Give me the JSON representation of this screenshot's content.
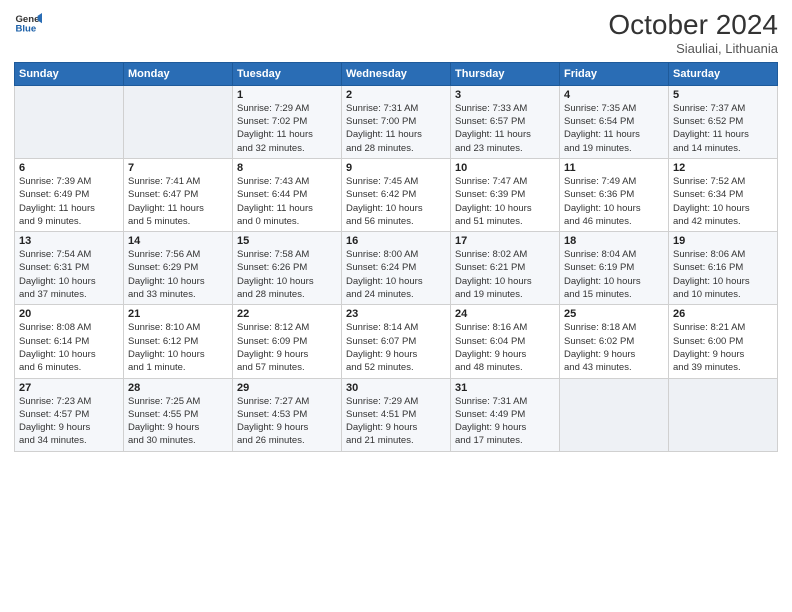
{
  "logo": {
    "line1": "General",
    "line2": "Blue"
  },
  "title": "October 2024",
  "subtitle": "Siauliai, Lithuania",
  "header_days": [
    "Sunday",
    "Monday",
    "Tuesday",
    "Wednesday",
    "Thursday",
    "Friday",
    "Saturday"
  ],
  "weeks": [
    [
      {
        "day": "",
        "info": ""
      },
      {
        "day": "",
        "info": ""
      },
      {
        "day": "1",
        "info": "Sunrise: 7:29 AM\nSunset: 7:02 PM\nDaylight: 11 hours\nand 32 minutes."
      },
      {
        "day": "2",
        "info": "Sunrise: 7:31 AM\nSunset: 7:00 PM\nDaylight: 11 hours\nand 28 minutes."
      },
      {
        "day": "3",
        "info": "Sunrise: 7:33 AM\nSunset: 6:57 PM\nDaylight: 11 hours\nand 23 minutes."
      },
      {
        "day": "4",
        "info": "Sunrise: 7:35 AM\nSunset: 6:54 PM\nDaylight: 11 hours\nand 19 minutes."
      },
      {
        "day": "5",
        "info": "Sunrise: 7:37 AM\nSunset: 6:52 PM\nDaylight: 11 hours\nand 14 minutes."
      }
    ],
    [
      {
        "day": "6",
        "info": "Sunrise: 7:39 AM\nSunset: 6:49 PM\nDaylight: 11 hours\nand 9 minutes."
      },
      {
        "day": "7",
        "info": "Sunrise: 7:41 AM\nSunset: 6:47 PM\nDaylight: 11 hours\nand 5 minutes."
      },
      {
        "day": "8",
        "info": "Sunrise: 7:43 AM\nSunset: 6:44 PM\nDaylight: 11 hours\nand 0 minutes."
      },
      {
        "day": "9",
        "info": "Sunrise: 7:45 AM\nSunset: 6:42 PM\nDaylight: 10 hours\nand 56 minutes."
      },
      {
        "day": "10",
        "info": "Sunrise: 7:47 AM\nSunset: 6:39 PM\nDaylight: 10 hours\nand 51 minutes."
      },
      {
        "day": "11",
        "info": "Sunrise: 7:49 AM\nSunset: 6:36 PM\nDaylight: 10 hours\nand 46 minutes."
      },
      {
        "day": "12",
        "info": "Sunrise: 7:52 AM\nSunset: 6:34 PM\nDaylight: 10 hours\nand 42 minutes."
      }
    ],
    [
      {
        "day": "13",
        "info": "Sunrise: 7:54 AM\nSunset: 6:31 PM\nDaylight: 10 hours\nand 37 minutes."
      },
      {
        "day": "14",
        "info": "Sunrise: 7:56 AM\nSunset: 6:29 PM\nDaylight: 10 hours\nand 33 minutes."
      },
      {
        "day": "15",
        "info": "Sunrise: 7:58 AM\nSunset: 6:26 PM\nDaylight: 10 hours\nand 28 minutes."
      },
      {
        "day": "16",
        "info": "Sunrise: 8:00 AM\nSunset: 6:24 PM\nDaylight: 10 hours\nand 24 minutes."
      },
      {
        "day": "17",
        "info": "Sunrise: 8:02 AM\nSunset: 6:21 PM\nDaylight: 10 hours\nand 19 minutes."
      },
      {
        "day": "18",
        "info": "Sunrise: 8:04 AM\nSunset: 6:19 PM\nDaylight: 10 hours\nand 15 minutes."
      },
      {
        "day": "19",
        "info": "Sunrise: 8:06 AM\nSunset: 6:16 PM\nDaylight: 10 hours\nand 10 minutes."
      }
    ],
    [
      {
        "day": "20",
        "info": "Sunrise: 8:08 AM\nSunset: 6:14 PM\nDaylight: 10 hours\nand 6 minutes."
      },
      {
        "day": "21",
        "info": "Sunrise: 8:10 AM\nSunset: 6:12 PM\nDaylight: 10 hours\nand 1 minute."
      },
      {
        "day": "22",
        "info": "Sunrise: 8:12 AM\nSunset: 6:09 PM\nDaylight: 9 hours\nand 57 minutes."
      },
      {
        "day": "23",
        "info": "Sunrise: 8:14 AM\nSunset: 6:07 PM\nDaylight: 9 hours\nand 52 minutes."
      },
      {
        "day": "24",
        "info": "Sunrise: 8:16 AM\nSunset: 6:04 PM\nDaylight: 9 hours\nand 48 minutes."
      },
      {
        "day": "25",
        "info": "Sunrise: 8:18 AM\nSunset: 6:02 PM\nDaylight: 9 hours\nand 43 minutes."
      },
      {
        "day": "26",
        "info": "Sunrise: 8:21 AM\nSunset: 6:00 PM\nDaylight: 9 hours\nand 39 minutes."
      }
    ],
    [
      {
        "day": "27",
        "info": "Sunrise: 7:23 AM\nSunset: 4:57 PM\nDaylight: 9 hours\nand 34 minutes."
      },
      {
        "day": "28",
        "info": "Sunrise: 7:25 AM\nSunset: 4:55 PM\nDaylight: 9 hours\nand 30 minutes."
      },
      {
        "day": "29",
        "info": "Sunrise: 7:27 AM\nSunset: 4:53 PM\nDaylight: 9 hours\nand 26 minutes."
      },
      {
        "day": "30",
        "info": "Sunrise: 7:29 AM\nSunset: 4:51 PM\nDaylight: 9 hours\nand 21 minutes."
      },
      {
        "day": "31",
        "info": "Sunrise: 7:31 AM\nSunset: 4:49 PM\nDaylight: 9 hours\nand 17 minutes."
      },
      {
        "day": "",
        "info": ""
      },
      {
        "day": "",
        "info": ""
      }
    ]
  ]
}
